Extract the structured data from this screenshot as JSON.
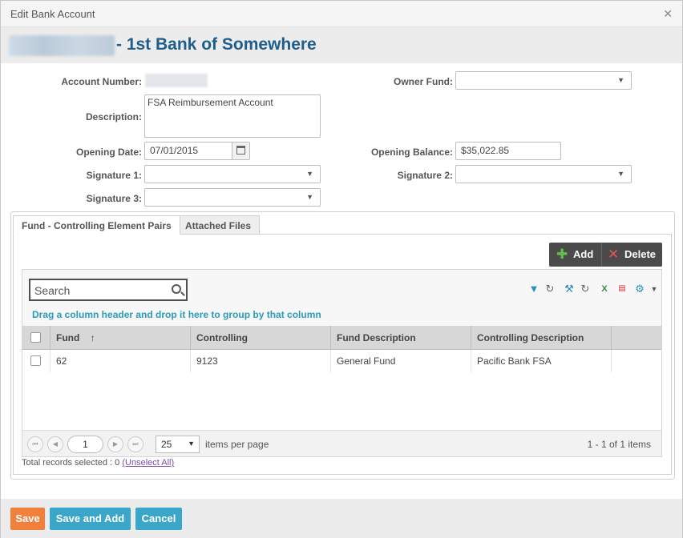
{
  "dialog": {
    "title": "Edit Bank Account"
  },
  "header": {
    "title": "- 1st Bank of Somewhere"
  },
  "form": {
    "account_number_label": "Account Number:",
    "owner_fund_label": "Owner Fund:",
    "owner_fund_value": "",
    "description_label": "Description:",
    "description_value": "FSA Reimbursement Account",
    "opening_date_label": "Opening Date:",
    "opening_date_value": "07/01/2015",
    "opening_balance_label": "Opening Balance:",
    "opening_balance_value": "$35,022.85",
    "signature1_label": "Signature 1:",
    "signature2_label": "Signature 2:",
    "signature3_label": "Signature 3:"
  },
  "tabs": [
    {
      "label": "Fund - Controlling Element Pairs",
      "active": true
    },
    {
      "label": "Attached Files",
      "active": false
    }
  ],
  "actions": {
    "add_label": "Add",
    "delete_label": "Delete"
  },
  "grid": {
    "search_placeholder": "Search",
    "group_hint": "Drag a column header and drop it here to group by that column",
    "columns": [
      "Fund",
      "Controlling",
      "Fund Description",
      "Controlling Description"
    ],
    "sort_indicator": "↑",
    "rows": [
      {
        "fund": "62",
        "controlling": "9123",
        "fund_description": "General Fund",
        "controlling_description": "Pacific Bank FSA"
      }
    ],
    "toolbar_icons": [
      "filter-icon",
      "refresh-icon",
      "wrench-icon",
      "refresh-icon",
      "excel-icon",
      "pdf-icon",
      "gear-icon",
      "chevron-down-icon"
    ],
    "pager": {
      "page": "1",
      "page_size": "25",
      "items_per_page_label": "items per page",
      "summary": "1 - 1 of 1 items"
    }
  },
  "selection": {
    "text": "Total records selected : 0",
    "unselect_label": "(Unselect All)"
  },
  "footer": {
    "save_label": "Save",
    "save_add_label": "Save and Add",
    "cancel_label": "Cancel"
  },
  "colors": {
    "accent_orange": "#f0803c",
    "accent_teal": "#3aa6c9",
    "header_blue": "#1f5d8d",
    "link_teal": "#2a9bb8"
  }
}
